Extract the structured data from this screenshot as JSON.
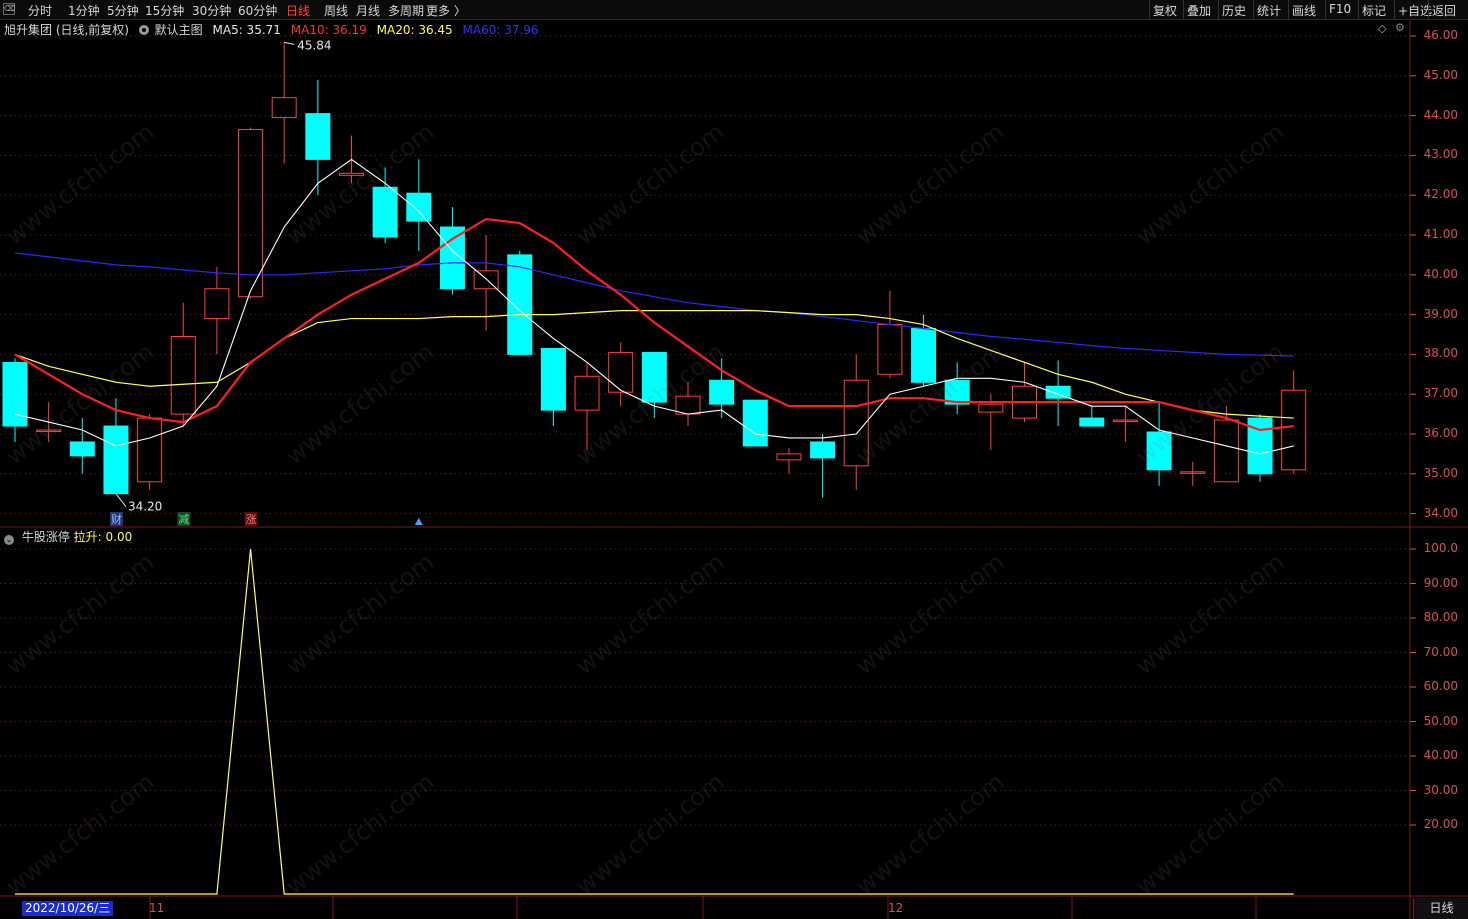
{
  "toolbar": {
    "logo": "⌫",
    "periods": [
      "分时",
      "1分钟",
      "5分钟",
      "15分钟",
      "30分钟",
      "60分钟",
      "日线",
      "周线",
      "月线",
      "多周期",
      "更多 〉"
    ],
    "active_period": "日线",
    "right": [
      "复权",
      "叠加",
      "历史",
      "统计",
      "画线",
      "F10",
      "标记",
      "+自选",
      "返回"
    ]
  },
  "info": {
    "stock": "旭升集团 (日线,前复权)",
    "template": "默认主图",
    "ma5": "MA5: 35.71",
    "ma10": "MA10: 36.19",
    "ma20": "MA20: 36.45",
    "ma60": "MA60: 37.96"
  },
  "sub": {
    "name": "牛股涨停",
    "value": "拉升: 0.00"
  },
  "colors": {
    "up": "#ff4040",
    "down": "#00ffff",
    "ma5": "#ffffff",
    "ma10": "#ff2020",
    "ma20": "#ffff66",
    "ma60": "#2a2aff",
    "grid": "#7a1a1a",
    "axis": "#d85050"
  },
  "icons": {
    "diamond": "diamond-icon",
    "options": "options-icon",
    "eye": "eye-icon",
    "collapse": "collapse-icon"
  },
  "markers": {
    "high": "45.84",
    "low": "34.20",
    "tags": [
      "财",
      "减",
      "涨"
    ]
  },
  "price_ticks": [
    "46.00",
    "45.00",
    "44.00",
    "43.00",
    "42.00",
    "41.00",
    "40.00",
    "39.00",
    "38.00",
    "37.00",
    "36.00",
    "35.00",
    "34.00"
  ],
  "sub_ticks": [
    "100.0",
    "90.00",
    "80.00",
    "70.00",
    "60.00",
    "50.00",
    "40.00",
    "30.00",
    "20.00"
  ],
  "dates": {
    "cursor": "2022/10/26/三",
    "m11": "11",
    "m12": "12"
  },
  "bottom_right": "日线",
  "watermark": "www.cfchi.com",
  "chart_data": {
    "type": "candlestick",
    "ylim": [
      34.0,
      46.0
    ],
    "candles": [
      {
        "o": 37.8,
        "h": 37.9,
        "l": 35.8,
        "c": 36.2
      },
      {
        "o": 36.1,
        "h": 36.8,
        "l": 35.8,
        "c": 36.1
      },
      {
        "o": 35.8,
        "h": 36.4,
        "l": 35.0,
        "c": 35.45
      },
      {
        "o": 36.2,
        "h": 36.9,
        "l": 34.5,
        "c": 34.5
      },
      {
        "o": 34.8,
        "h": 36.5,
        "l": 34.6,
        "c": 36.4
      },
      {
        "o": 36.5,
        "h": 39.3,
        "l": 36.2,
        "c": 38.45
      },
      {
        "o": 38.9,
        "h": 40.2,
        "l": 38.0,
        "c": 39.65
      },
      {
        "o": 39.45,
        "h": 43.7,
        "l": 39.4,
        "c": 43.65
      },
      {
        "o": 43.95,
        "h": 45.84,
        "l": 42.8,
        "c": 44.45
      },
      {
        "o": 44.05,
        "h": 44.9,
        "l": 42.0,
        "c": 42.9
      },
      {
        "o": 42.5,
        "h": 43.5,
        "l": 42.3,
        "c": 42.55
      },
      {
        "o": 42.2,
        "h": 42.7,
        "l": 40.8,
        "c": 40.95
      },
      {
        "o": 42.05,
        "h": 42.9,
        "l": 40.6,
        "c": 41.35
      },
      {
        "o": 41.2,
        "h": 41.7,
        "l": 39.5,
        "c": 39.65
      },
      {
        "o": 39.65,
        "h": 41.0,
        "l": 38.6,
        "c": 40.1
      },
      {
        "o": 40.5,
        "h": 40.6,
        "l": 38.0,
        "c": 38.0
      },
      {
        "o": 38.15,
        "h": 38.15,
        "l": 36.2,
        "c": 36.6
      },
      {
        "o": 36.6,
        "h": 37.8,
        "l": 35.6,
        "c": 37.45
      },
      {
        "o": 37.05,
        "h": 38.3,
        "l": 36.7,
        "c": 38.05
      },
      {
        "o": 38.05,
        "h": 38.05,
        "l": 36.4,
        "c": 36.8
      },
      {
        "o": 36.5,
        "h": 37.3,
        "l": 36.2,
        "c": 36.95
      },
      {
        "o": 37.35,
        "h": 37.9,
        "l": 36.4,
        "c": 36.75
      },
      {
        "o": 36.85,
        "h": 36.85,
        "l": 35.7,
        "c": 35.7
      },
      {
        "o": 35.35,
        "h": 35.65,
        "l": 35.0,
        "c": 35.5
      },
      {
        "o": 35.8,
        "h": 36.0,
        "l": 34.4,
        "c": 35.4
      },
      {
        "o": 35.2,
        "h": 38.0,
        "l": 34.6,
        "c": 37.35
      },
      {
        "o": 37.5,
        "h": 39.6,
        "l": 37.4,
        "c": 38.75
      },
      {
        "o": 38.65,
        "h": 39.0,
        "l": 37.2,
        "c": 37.3
      },
      {
        "o": 37.35,
        "h": 37.8,
        "l": 36.5,
        "c": 36.75
      },
      {
        "o": 36.55,
        "h": 37.0,
        "l": 35.6,
        "c": 36.75
      },
      {
        "o": 36.4,
        "h": 37.8,
        "l": 36.3,
        "c": 37.2
      },
      {
        "o": 37.2,
        "h": 37.85,
        "l": 36.2,
        "c": 36.9
      },
      {
        "o": 36.4,
        "h": 36.7,
        "l": 36.2,
        "c": 36.2
      },
      {
        "o": 36.35,
        "h": 36.7,
        "l": 35.8,
        "c": 36.35
      },
      {
        "o": 36.05,
        "h": 36.8,
        "l": 34.7,
        "c": 35.1
      },
      {
        "o": 35.05,
        "h": 35.3,
        "l": 34.7,
        "c": 35.05
      },
      {
        "o": 34.8,
        "h": 36.7,
        "l": 34.8,
        "c": 36.35
      },
      {
        "o": 36.4,
        "h": 36.5,
        "l": 34.8,
        "c": 35.0
      },
      {
        "o": 35.1,
        "h": 37.6,
        "l": 35.0,
        "c": 37.1
      }
    ],
    "ma5": [
      36.5,
      36.3,
      36.1,
      35.7,
      35.9,
      36.2,
      37.2,
      39.6,
      41.2,
      42.3,
      42.9,
      42.3,
      41.6,
      40.6,
      39.9,
      39.1,
      38.4,
      37.8,
      37.1,
      36.7,
      36.5,
      36.6,
      36.0,
      35.9,
      35.9,
      36.0,
      37.0,
      37.2,
      37.4,
      37.4,
      37.3,
      37.0,
      36.7,
      36.7,
      36.1,
      35.9,
      35.7,
      35.5,
      35.7
    ],
    "ma10": [
      38.0,
      37.5,
      37.0,
      36.6,
      36.4,
      36.3,
      36.7,
      37.8,
      38.4,
      39.0,
      39.5,
      39.9,
      40.3,
      40.9,
      41.4,
      41.3,
      40.8,
      40.1,
      39.5,
      38.8,
      38.2,
      37.6,
      37.1,
      36.7,
      36.7,
      36.7,
      36.9,
      36.9,
      36.8,
      36.8,
      36.8,
      36.8,
      36.8,
      36.8,
      36.8,
      36.6,
      36.4,
      36.1,
      36.2
    ],
    "ma20": [
      38.0,
      37.7,
      37.5,
      37.3,
      37.2,
      37.25,
      37.3,
      37.8,
      38.4,
      38.8,
      38.9,
      38.9,
      38.9,
      38.95,
      38.95,
      39.0,
      39.0,
      39.05,
      39.1,
      39.1,
      39.1,
      39.1,
      39.1,
      39.05,
      39.0,
      39.0,
      38.9,
      38.75,
      38.4,
      38.1,
      37.8,
      37.5,
      37.3,
      37.0,
      36.8,
      36.6,
      36.5,
      36.45,
      36.4
    ],
    "ma60": [
      40.55,
      40.45,
      40.35,
      40.25,
      40.2,
      40.12,
      40.05,
      40.0,
      40.0,
      40.05,
      40.1,
      40.15,
      40.25,
      40.3,
      40.3,
      40.2,
      40.0,
      39.8,
      39.6,
      39.45,
      39.3,
      39.2,
      39.1,
      39.05,
      38.95,
      38.85,
      38.75,
      38.65,
      38.55,
      38.45,
      38.38,
      38.3,
      38.22,
      38.15,
      38.1,
      38.05,
      38.0,
      37.98,
      37.96
    ],
    "sub_series": [
      0,
      0,
      0,
      0,
      0,
      0,
      0,
      100,
      0,
      0,
      0,
      0,
      0,
      0,
      0,
      0,
      0,
      0,
      0,
      0,
      0,
      0,
      0,
      0,
      0,
      0,
      0,
      0,
      0,
      0,
      0,
      0,
      0,
      0,
      0,
      0,
      0,
      0,
      0
    ],
    "sub_ylim": [
      0,
      100
    ]
  }
}
